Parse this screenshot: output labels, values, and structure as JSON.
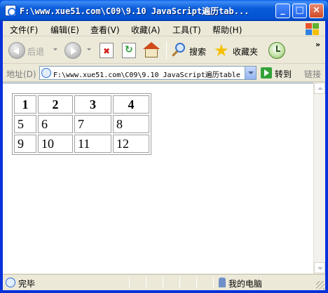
{
  "window": {
    "title": "F:\\www.xue51.com\\C09\\9.10 JavaScript遍历tab...",
    "minimize": "_",
    "maximize": "□",
    "close": "×"
  },
  "menu": [
    "文件(F)",
    "编辑(E)",
    "查看(V)",
    "收藏(A)",
    "工具(T)",
    "帮助(H)"
  ],
  "toolbar": {
    "back": "后退",
    "search": "搜索",
    "favorites": "收藏夹"
  },
  "address": {
    "label": "地址(D)",
    "value": "F:\\www.xue51.com\\C09\\9.10 JavaScript遍历table",
    "go": "转到",
    "links": "链接"
  },
  "table": {
    "header": [
      "1",
      "2",
      "3",
      "4"
    ],
    "rows": [
      [
        "5",
        "6",
        "7",
        "8"
      ],
      [
        "9",
        "10",
        "11",
        "12"
      ]
    ]
  },
  "status": {
    "text": "完毕",
    "zone": "我的电脑"
  }
}
